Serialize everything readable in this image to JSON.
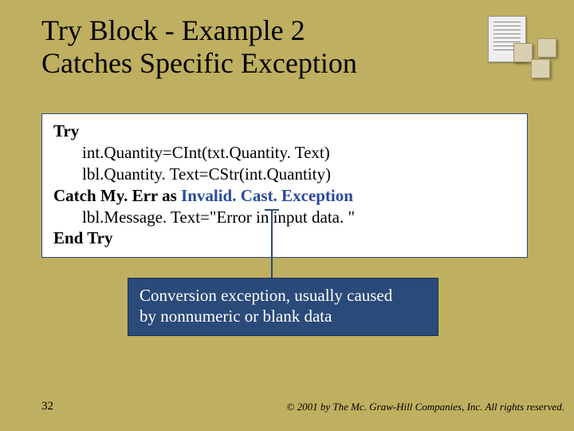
{
  "title": {
    "line1": "Try Block - Example 2",
    "line2": "Catches Specific Exception"
  },
  "code": {
    "kw_try": "Try",
    "line1": "int.Quantity=CInt(txt.Quantity. Text)",
    "line2": "lbl.Quantity. Text=CStr(int.Quantity)",
    "kw_catch": "Catch ",
    "catch_var": "My. Err as ",
    "exc": "Invalid. Cast. Exception",
    "line3": "lbl.Message. Text=\"Error in input data. \"",
    "kw_end": "End Try"
  },
  "callout": {
    "line1": "Conversion exception, usually caused",
    "line2": "by nonnumeric or blank data"
  },
  "footer": {
    "page": "32",
    "copyright": "© 2001 by The Mc. Graw-Hill Companies, Inc. All rights reserved."
  }
}
